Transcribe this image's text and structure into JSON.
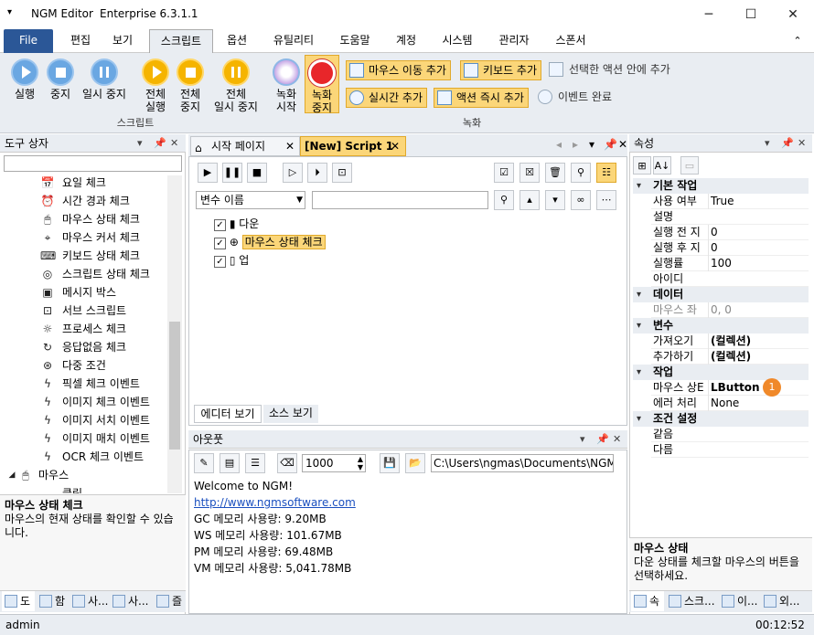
{
  "window": {
    "app_name": "NGM Editor",
    "edition": "Enterprise 6.3.1.1"
  },
  "menu": {
    "file": "File",
    "items": [
      "편집",
      "보기",
      "스크립트",
      "옵션",
      "유틸리티",
      "도움말",
      "계정",
      "시스템",
      "관리자",
      "스폰서"
    ]
  },
  "ribbon": {
    "script_group": "스크립트",
    "record_group": "녹화",
    "run": "실행",
    "stop": "중지",
    "pause": "일시 중지",
    "run_all_1": "전체",
    "run_all_2": "실행",
    "stop_all_1": "전체",
    "stop_all_2": "중지",
    "pause_all_1": "전체",
    "pause_all_2": "일시 중지",
    "rec_start_1": "녹화",
    "rec_start_2": "시작",
    "rec_stop_1": "녹화",
    "rec_stop_2": "중지",
    "add_mouse_move": "마우스 이동 추가",
    "add_keyboard": "키보드 추가",
    "add_into_selected": "선택한 액션 안에 추가",
    "add_realtime": "실시간 추가",
    "action_instant_add": "액션 즉시 추가",
    "event_done": "이벤트 완료"
  },
  "toolbox": {
    "title": "도구 상자",
    "items": [
      "요일 체크",
      "시간 경과 체크",
      "마우스 상태 체크",
      "마우스 커서 체크",
      "키보드 상태 체크",
      "스크립트 상태 체크",
      "메시지 박스",
      "서브 스크립트",
      "프로세스 체크",
      "응답없음 체크",
      "다중 조건",
      "픽셀 체크 이벤트",
      "이미지 체크 이벤트",
      "이미지 서치 이벤트",
      "이미지 매치 이벤트",
      "OCR 체크 이벤트"
    ],
    "mouse_node": "마우스",
    "mouse_child": "클릭",
    "desc_title": "마우스 상태 체크",
    "desc_text": "마우스의 현재 상태를 확인할 수 있습니다.",
    "tabs": [
      "도",
      "함",
      "사...",
      "사...",
      "즐"
    ]
  },
  "editor": {
    "tabs": [
      "시작 페이지",
      "[New] Script 1"
    ],
    "var_select": "변수 이름",
    "actions": [
      "다운",
      "마우스 상태 체크",
      "업"
    ],
    "bottom_tabs": [
      "에디터 보기",
      "소스 보기"
    ]
  },
  "output": {
    "title": "아웃풋",
    "interval": "1000",
    "path": "C:\\Users\\ngmas\\Documents\\NGM6\\",
    "lines": [
      "Welcome to NGM!",
      "http://www.ngmsoftware.com",
      "GC 메모리 사용량: 9.20MB",
      "WS 메모리 사용량: 101.67MB",
      "PM 메모리 사용량: 69.48MB",
      "VM 메모리 사용량: 5,041.78MB"
    ]
  },
  "properties": {
    "title": "속성",
    "cat_basic": "기본 작업",
    "enabled_k": "사용 여부",
    "enabled_v": "True",
    "desc_k": "설명",
    "before_k": "실행 전 지",
    "before_v": "0",
    "after_k": "실행 후 지",
    "after_v": "0",
    "rate_k": "실행률",
    "rate_v": "100",
    "id_k": "아이디",
    "cat_data": "데이터",
    "coord_k": "마우스 좌",
    "coord_v": "0, 0",
    "cat_var": "변수",
    "get_k": "가져오기",
    "get_v": "(컬렉션)",
    "add_k": "추가하기",
    "add_v": "(컬렉션)",
    "cat_action": "작업",
    "mstate_k": "마우스 상E",
    "mstate_v": "LButton",
    "badge": "1",
    "err_k": "에러 처리",
    "err_v": "None",
    "cat_cond": "조건 설정",
    "eq_k": "같음",
    "ne_k": "다름",
    "desc_title": "마우스 상태",
    "desc_text": "다운 상태를 체크할 마우스의 버튼을 선택하세요.",
    "tabs": [
      "속",
      "스크...",
      "이...",
      "외..."
    ]
  },
  "status": {
    "user": "admin",
    "time": "00:12:52"
  },
  "colors": {
    "accent": "#2b5797",
    "highlight": "#fbd679",
    "badge": "#f0892a"
  }
}
